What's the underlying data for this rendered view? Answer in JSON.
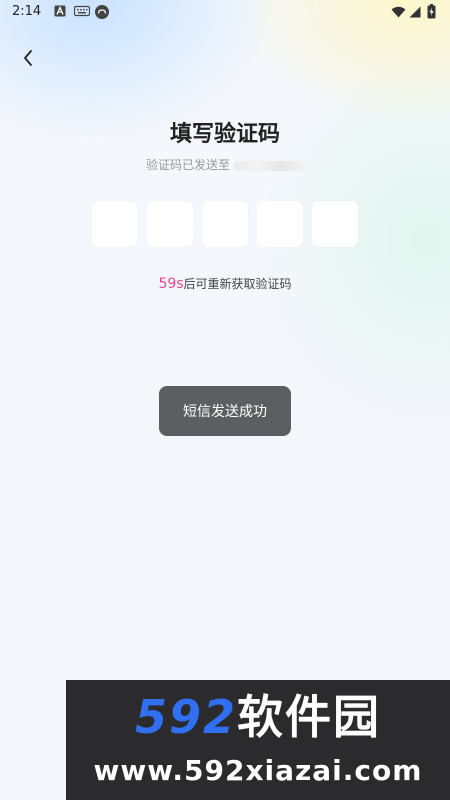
{
  "status_bar": {
    "time": "2:14",
    "left_icons": [
      "a-notification-icon",
      "keyboard-icon",
      "cloud-app-icon"
    ],
    "right_icons": [
      "wifi-icon",
      "signal-icon",
      "battery-charging-icon"
    ]
  },
  "header": {
    "back_icon": "chevron-left-icon"
  },
  "main": {
    "title": "填写验证码",
    "subtitle_prefix": "验证码已发送至",
    "code_boxes": [
      "",
      "",
      "",
      "",
      ""
    ],
    "resend": {
      "countdown": "59s",
      "text": "后可重新获取验证码"
    }
  },
  "toast": {
    "message": "短信发送成功"
  },
  "watermark": {
    "logo_number": "592",
    "logo_text": "软件园",
    "url": "www.592xiazai.com"
  },
  "colors": {
    "accent_pink": "#e8458e",
    "toast_bg": "#5d5e61",
    "watermark_bg": "#2b2b2d",
    "watermark_blue": "#2f6ff0"
  }
}
